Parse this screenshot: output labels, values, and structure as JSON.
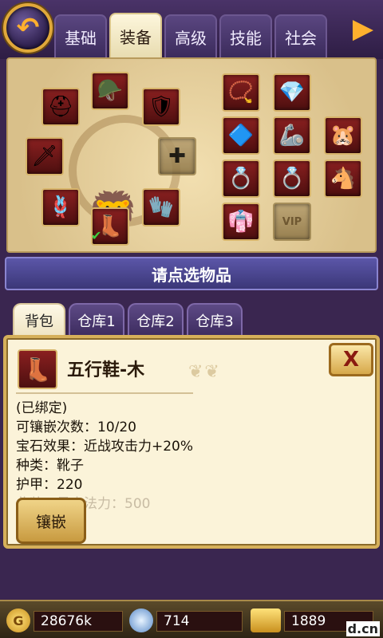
{
  "top_tabs": [
    "基础",
    "装备",
    "高级",
    "技能",
    "社会"
  ],
  "active_top_tab": 1,
  "hint_text": "请点选物品",
  "bag_tabs": [
    "背包",
    "仓库1",
    "仓库2",
    "仓库3"
  ],
  "item": {
    "name": "五行鞋-木",
    "bound": "(已绑定)",
    "inlay_count": "可镶嵌次数：10/20",
    "gem_effect": "宝石效果：近战攻击力+20%",
    "type": "种类：靴子",
    "armor": "护甲：220",
    "faded_line": "此装…最大法力：500"
  },
  "inlay_button": "镶嵌",
  "close_button": "X",
  "resources": {
    "gold": "28676k",
    "gems": "714",
    "gold_bars": "1889"
  },
  "watermark": "d.cn",
  "vip_label": "VIP",
  "icons": {
    "back": "back-arrow-icon",
    "next": "next-arrow-icon",
    "helmet": "helmet-icon",
    "armor": "armor-icon",
    "shoulder": "shoulder-icon",
    "sword": "sword-icon",
    "belt": "belt-icon",
    "gloves": "gloves-icon",
    "boots": "boots-icon",
    "shield": "shield-icon",
    "necklace": "necklace-icon",
    "amulet": "amulet-icon",
    "ring": "ring-icon",
    "pet": "pet-icon",
    "mount": "mount-icon",
    "costume": "costume-icon"
  }
}
